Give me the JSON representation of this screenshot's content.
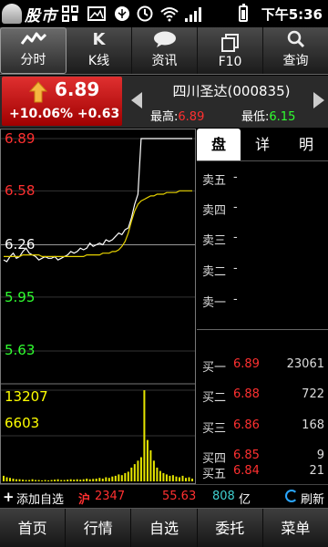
{
  "status_bar": {
    "app_name": "股市",
    "time": "下午5:36",
    "icons": [
      "grid-icon",
      "image-icon",
      "usb-icon",
      "clock-icon",
      "wifi-icon",
      "signal-icon",
      "battery-icon"
    ]
  },
  "tabs": [
    {
      "label": "分时",
      "icon": "wave-icon",
      "active": true
    },
    {
      "label": "K线",
      "icon": "k-icon",
      "glyph": "K",
      "active": false
    },
    {
      "label": "资讯",
      "icon": "chat-bubble-icon",
      "active": false
    },
    {
      "label": "F10",
      "icon": "pages-icon",
      "active": false
    },
    {
      "label": "查询",
      "icon": "search-icon",
      "active": false
    }
  ],
  "quote": {
    "last_price": "6.89",
    "change_pct": "+10.06%",
    "change": "+0.63",
    "stock_name": "四川圣达(000835)",
    "high_label": "最高:",
    "high": "6.89",
    "low_label": "最低:",
    "low": "6.15"
  },
  "chart": {
    "y_labels": [
      {
        "text": "6.89",
        "color": "#ff3030"
      },
      {
        "text": "6.58",
        "color": "#ff3030"
      },
      {
        "text": "6.26",
        "color": "#ffffff"
      },
      {
        "text": "5.95",
        "color": "#30ff30"
      },
      {
        "text": "5.63",
        "color": "#30ff30"
      }
    ],
    "volume_labels": [
      {
        "text": "13207",
        "color": "#ffff00"
      },
      {
        "text": "6603",
        "color": "#ffff00"
      }
    ]
  },
  "chart_data": {
    "type": "line",
    "title": "",
    "price_axis": {
      "ylim": [
        5.63,
        6.89
      ],
      "ticks": [
        6.89,
        6.58,
        6.26,
        5.95,
        5.63
      ],
      "prev_close": 6.26
    },
    "volume_axis": {
      "ylim": [
        0,
        13207
      ],
      "ticks": [
        13207,
        6603
      ]
    },
    "x_count": 60,
    "series": [
      {
        "color": "#ffffff",
        "values": [
          6.17,
          6.16,
          6.19,
          6.21,
          6.18,
          6.19,
          6.22,
          6.24,
          6.21,
          6.2,
          6.19,
          6.17,
          6.18,
          6.19,
          6.18,
          6.18,
          6.19,
          6.17,
          6.18,
          6.19,
          6.2,
          6.22,
          6.21,
          6.22,
          6.24,
          6.23,
          6.24,
          6.27,
          6.25,
          6.26,
          6.27,
          6.26,
          6.29,
          6.28,
          6.29,
          6.31,
          6.33,
          6.32,
          6.35,
          6.36,
          6.42,
          6.5,
          6.56,
          6.89,
          6.89,
          6.89,
          6.89,
          6.89,
          6.89,
          6.89,
          6.89,
          6.89,
          6.89,
          6.89,
          6.89,
          6.89,
          6.89,
          6.89,
          6.89,
          6.89
        ]
      },
      {
        "color": "#e6d200",
        "values": [
          6.19,
          6.19,
          6.19,
          6.19,
          6.19,
          6.19,
          6.2,
          6.2,
          6.2,
          6.2,
          6.2,
          6.2,
          6.19,
          6.19,
          6.19,
          6.19,
          6.19,
          6.19,
          6.19,
          6.19,
          6.19,
          6.19,
          6.19,
          6.19,
          6.19,
          6.19,
          6.2,
          6.2,
          6.2,
          6.2,
          6.2,
          6.21,
          6.21,
          6.21,
          6.22,
          6.22,
          6.23,
          6.25,
          6.28,
          6.33,
          6.4,
          6.46,
          6.5,
          6.52,
          6.53,
          6.54,
          6.55,
          6.55,
          6.56,
          6.56,
          6.56,
          6.57,
          6.57,
          6.57,
          6.57,
          6.58,
          6.58,
          6.58,
          6.58,
          6.58
        ]
      }
    ],
    "volume": [
      800,
      600,
      500,
      400,
      300,
      300,
      250,
      200,
      200,
      300,
      200,
      200,
      150,
      200,
      150,
      200,
      250,
      300,
      200,
      200,
      250,
      300,
      250,
      300,
      250,
      300,
      400,
      300,
      350,
      400,
      500,
      400,
      600,
      500,
      700,
      800,
      1000,
      900,
      1200,
      1400,
      2000,
      2500,
      3000,
      3500,
      13207,
      6000,
      4500,
      3000,
      2000,
      1500,
      1200,
      1000,
      800,
      900,
      700,
      600,
      800,
      500,
      600,
      400
    ]
  },
  "order_book": {
    "tabs": [
      {
        "label": "盘",
        "active": true
      },
      {
        "label": "详",
        "active": false
      },
      {
        "label": "明",
        "active": false
      }
    ],
    "sell": [
      {
        "label": "卖五",
        "price": "-",
        "volume": ""
      },
      {
        "label": "卖四",
        "price": "-",
        "volume": ""
      },
      {
        "label": "卖三",
        "price": "-",
        "volume": ""
      },
      {
        "label": "卖二",
        "price": "-",
        "volume": ""
      },
      {
        "label": "卖一",
        "price": "-",
        "volume": ""
      }
    ],
    "buy": [
      {
        "label": "买一",
        "price": "6.89",
        "volume": "23061"
      },
      {
        "label": "买二",
        "price": "6.88",
        "volume": "722"
      },
      {
        "label": "买三",
        "price": "6.86",
        "volume": "168"
      },
      {
        "label": "买四",
        "price": "6.85",
        "volume": "9"
      },
      {
        "label": "买五",
        "price": "6.84",
        "volume": "21"
      }
    ]
  },
  "index_bar": {
    "add_label": "添加自选",
    "market": "沪",
    "index_value": "2347",
    "index_change": "55.63",
    "amount": "808",
    "amount_unit": "亿",
    "refresh_label": "刷新"
  },
  "bottom_nav": [
    "首页",
    "行情",
    "自选",
    "委托",
    "菜单"
  ]
}
